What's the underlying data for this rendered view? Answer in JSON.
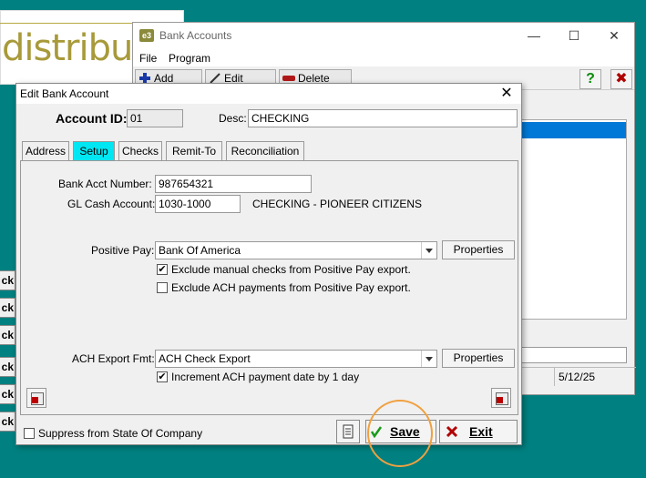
{
  "background": {
    "logo_text": "distribute",
    "side_buttons": [
      "ck",
      "ck",
      "ck",
      "ck",
      "ck",
      "ck"
    ]
  },
  "bank_window": {
    "title": "Bank Accounts",
    "app_icon": "e3",
    "menu": [
      "File",
      "Program"
    ],
    "toolbar": {
      "add": "Add",
      "edit": "Edit",
      "delete": "Delete",
      "help": "?",
      "close": "✖"
    },
    "status_date": "5/12/25"
  },
  "dialog": {
    "title": "Edit Bank Account",
    "account_id_label": "Account ID:",
    "account_id": "01",
    "desc_label": "Desc:",
    "desc": "CHECKING",
    "tabs": [
      "Address",
      "Setup",
      "Checks",
      "Remit-To",
      "Reconciliation"
    ],
    "active_tab": "Setup",
    "setup": {
      "bank_acct_label": "Bank Acct Number:",
      "bank_acct": "987654321",
      "gl_cash_label": "GL Cash Account:",
      "gl_cash": "1030-1000",
      "gl_cash_desc": "CHECKING - PIONEER CITIZENS",
      "positive_pay_label": "Positive Pay:",
      "positive_pay": "Bank Of America",
      "properties": "Properties",
      "exclude_manual": "Exclude manual checks from Positive Pay export.",
      "exclude_manual_checked": "✔",
      "exclude_ach": "Exclude ACH payments from Positive Pay export.",
      "ach_export_label": "ACH Export Fmt:",
      "ach_export": "ACH Check Export",
      "increment_ach": "Increment ACH payment date by 1 day",
      "increment_ach_checked": "✔"
    },
    "suppress_label": "Suppress from State Of Company",
    "save": "Save",
    "exit": "Exit"
  },
  "colors": {
    "active_tab": "#00e6f2",
    "highlight_ring": "#f0a040",
    "desktop": "#008080"
  }
}
